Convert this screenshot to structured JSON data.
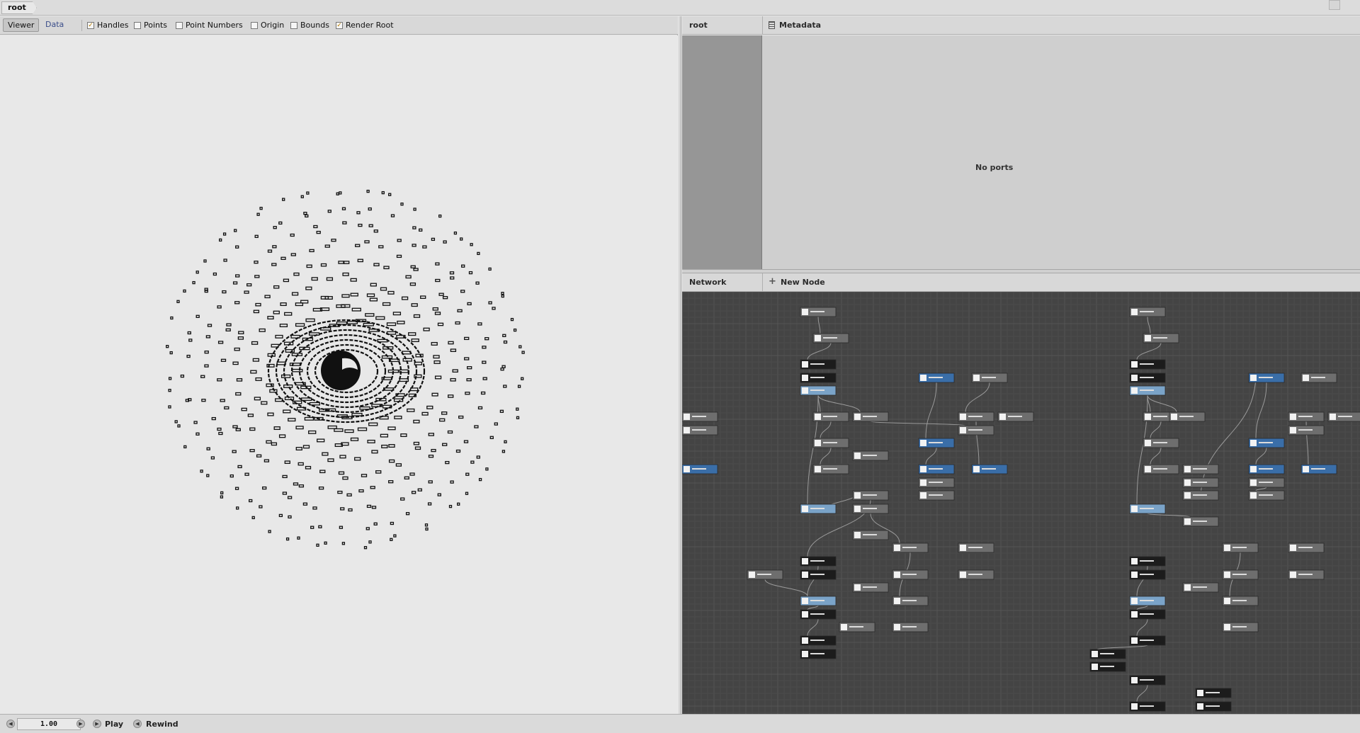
{
  "breadcrumb": {
    "root": "root"
  },
  "viewer": {
    "tabs": [
      {
        "label": "Viewer",
        "active": true
      },
      {
        "label": "Data",
        "active": false
      }
    ],
    "toggles": [
      {
        "label": "Handles",
        "checked": true
      },
      {
        "label": "Points",
        "checked": false
      },
      {
        "label": "Point Numbers",
        "checked": false
      },
      {
        "label": "Origin",
        "checked": false
      },
      {
        "label": "Bounds",
        "checked": false
      },
      {
        "label": "Render Root",
        "checked": true
      }
    ]
  },
  "ports": {
    "node_name": "root",
    "metadata_label": "Metadata",
    "empty_text": "No ports"
  },
  "network": {
    "title": "Network",
    "new_node_label": "New Node"
  },
  "playback": {
    "frame": "1.00",
    "play_label": "Play",
    "rewind_label": "Rewind"
  },
  "colors": {
    "node_gray": "#6e6e6e",
    "node_black": "#1c1c1c",
    "node_light_blue": "#7aa3c8",
    "node_blue": "#3a6ea8",
    "network_bg": "#444444",
    "wire": "#9a9a9a"
  },
  "icons": {
    "checkbox": "check-icon",
    "network_add": "plus-icon",
    "prev_frame": "arrow-left-icon",
    "next_frame": "arrow-right-icon",
    "play": "play-icon",
    "rewind": "rewind-icon",
    "metadata": "list-icon"
  }
}
